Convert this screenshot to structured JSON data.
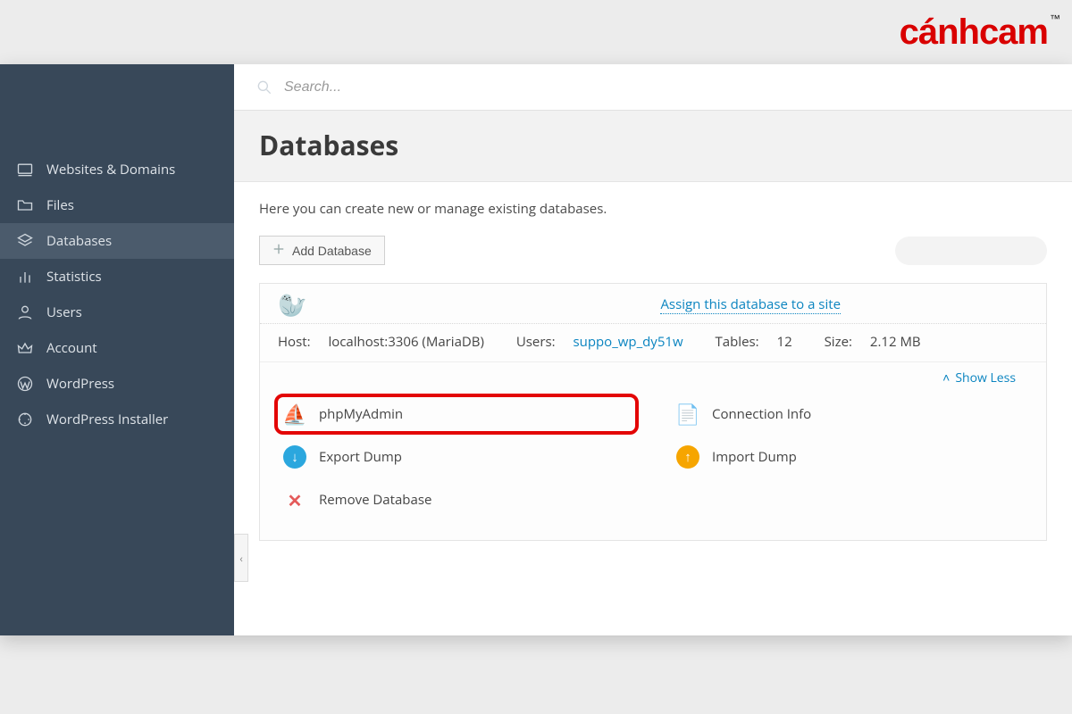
{
  "brand": {
    "name_pre": "cánh",
    "name_accent": "cam",
    "tm": "™"
  },
  "search": {
    "placeholder": "Search..."
  },
  "sidebar": {
    "items": [
      {
        "label": "Websites & Domains"
      },
      {
        "label": "Files"
      },
      {
        "label": "Databases"
      },
      {
        "label": "Statistics"
      },
      {
        "label": "Users"
      },
      {
        "label": "Account"
      },
      {
        "label": "WordPress"
      },
      {
        "label": "WordPress Installer"
      }
    ]
  },
  "page": {
    "title": "Databases",
    "intro": "Here you can create new or manage existing databases.",
    "add_button": "Add Database"
  },
  "db": {
    "assign_link": "Assign this database to a site",
    "host_label": "Host:",
    "host_value": "localhost:3306 (MariaDB)",
    "users_label": "Users:",
    "users_value": "suppo_wp_dy51w",
    "tables_label": "Tables:",
    "tables_value": "12",
    "size_label": "Size:",
    "size_value": "2.12 MB",
    "show_less": "Show Less",
    "actions": {
      "phpmyadmin": "phpMyAdmin",
      "conn_info": "Connection Info",
      "export_dump": "Export Dump",
      "import_dump": "Import Dump",
      "remove": "Remove Database"
    }
  },
  "collapse_glyph": "‹"
}
